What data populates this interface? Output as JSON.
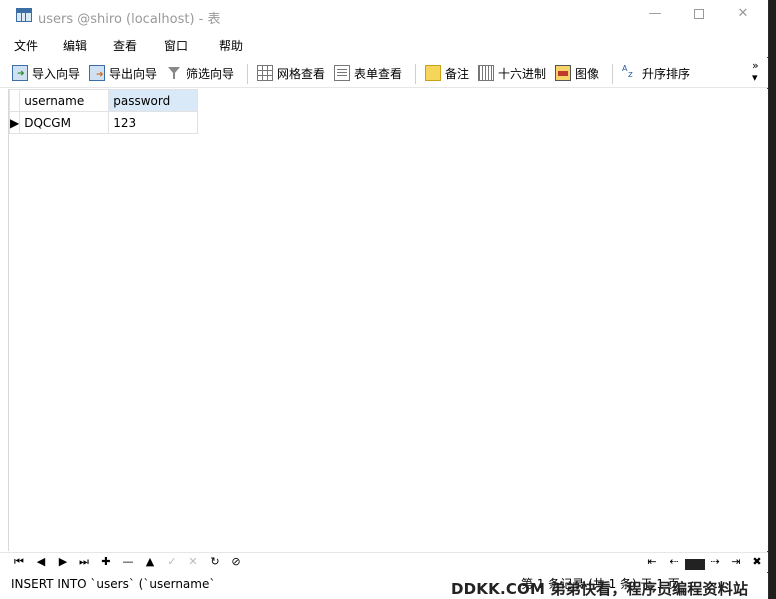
{
  "window": {
    "title": "users @shiro (localhost) - 表",
    "minimize": "—",
    "maximize": "",
    "close": "✕"
  },
  "menu": {
    "items": [
      {
        "label": "文件"
      },
      {
        "label": "编辑"
      },
      {
        "label": "查看"
      },
      {
        "label": "窗口"
      },
      {
        "label": "帮助"
      }
    ]
  },
  "toolbar": {
    "import_wizard": "导入向导",
    "export_wizard": "导出向导",
    "filter_wizard": "筛选向导",
    "grid_view": "网格查看",
    "form_view": "表单查看",
    "memo": "备注",
    "hex": "十六进制",
    "image": "图像",
    "sort_asc": "升序排序",
    "more": "»"
  },
  "table": {
    "columns": [
      "username",
      "password"
    ],
    "rows": [
      {
        "indicator": "▶",
        "username": "DQCGM",
        "password": "123"
      }
    ]
  },
  "navigation": {
    "first": "⏮",
    "prev": "◀",
    "next": "▶",
    "last": "⏭",
    "add": "✚",
    "delete": "—",
    "up": "▲",
    "apply": "✓",
    "cancel": "✕",
    "refresh": "↻",
    "stop": "⊘",
    "page_first": "⇤",
    "page_prev": "⇠",
    "page_next": "⇢",
    "page_last": "⇥",
    "settings": "✖"
  },
  "status": {
    "sql_preview": "INSERT INTO `users` (`username`",
    "record_info": "第 1 条记录 (共 1 条) 于 1 页",
    "watermark": "DDKK.COM 弟弟快看，程序员编程资料站"
  }
}
